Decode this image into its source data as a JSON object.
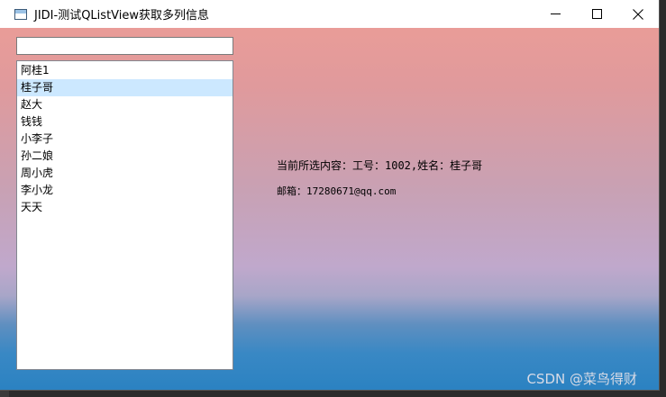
{
  "window": {
    "title": "JIDI-测试QListView获取多列信息",
    "icon": "app-window-icon"
  },
  "controls": {
    "minimize_icon": "minimize-icon",
    "maximize_icon": "maximize-icon",
    "close_icon": "close-icon"
  },
  "search": {
    "value": "",
    "placeholder": ""
  },
  "list": {
    "selected_index": 1,
    "items": [
      {
        "label": "阿桂1"
      },
      {
        "label": "桂子哥"
      },
      {
        "label": "赵大"
      },
      {
        "label": "钱钱"
      },
      {
        "label": "小李子"
      },
      {
        "label": "孙二娘"
      },
      {
        "label": "周小虎"
      },
      {
        "label": "李小龙"
      },
      {
        "label": "天天"
      }
    ]
  },
  "info": {
    "selection_text": "当前所选内容：工号：1002,姓名：桂子哥",
    "email_text": "邮箱：17280671@qq.com"
  },
  "watermark": "CSDN @菜鸟得财",
  "colors": {
    "selection": "#cce8ff",
    "gradient_top": "#e99c98",
    "gradient_mid": "#c0a8cc",
    "gradient_bottom": "#2b82c2"
  }
}
